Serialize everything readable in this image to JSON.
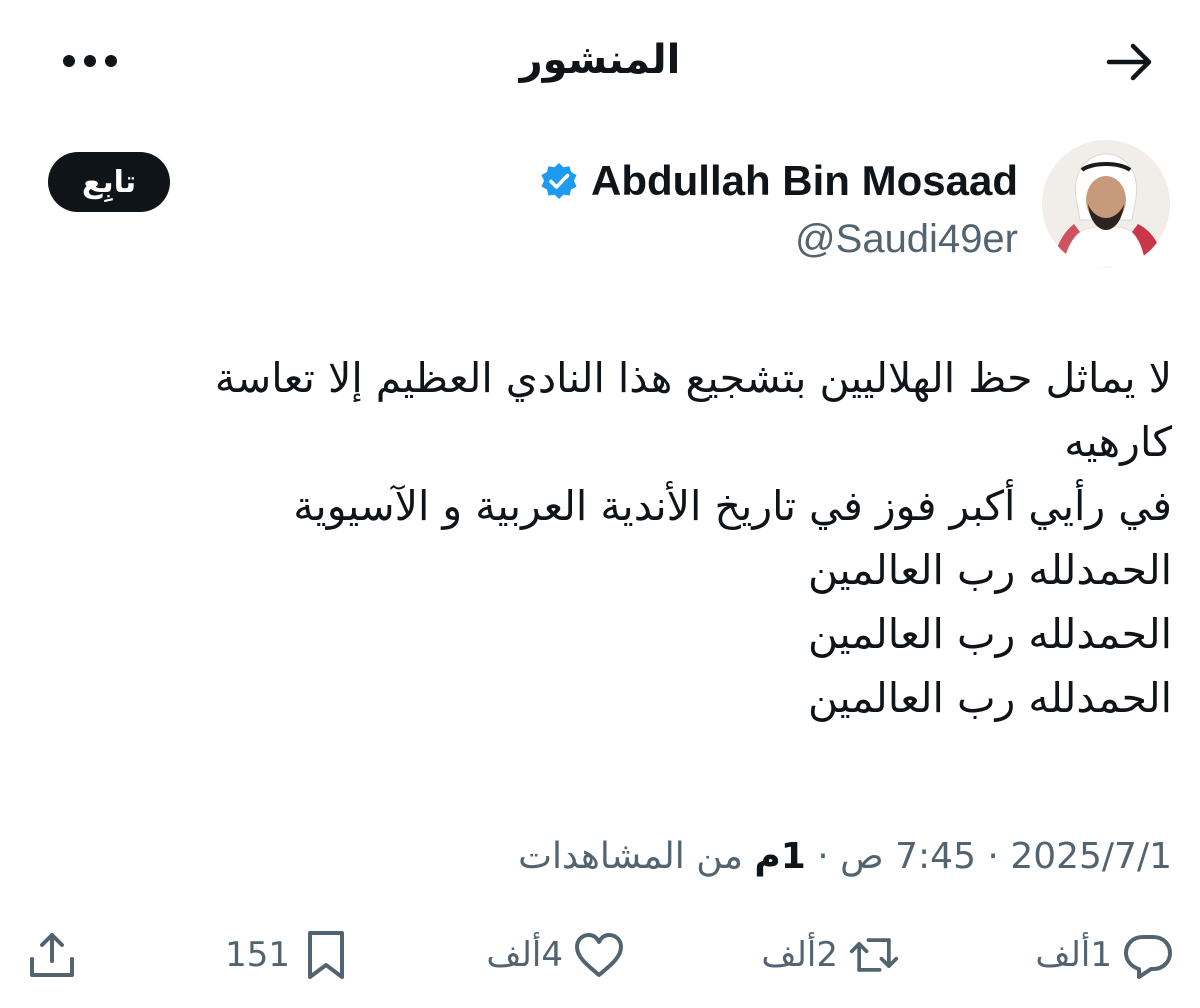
{
  "header": {
    "title": "المنشور"
  },
  "author": {
    "name": "Abdullah Bin Mosaad",
    "handle": "@Saudi49er",
    "verified": true,
    "follow_label": "تابِع"
  },
  "tweet": {
    "lines": [
      "لا يماثل حظ الهلاليين بتشجيع هذا النادي العظيم إلا تعاسة",
      "كارهيه",
      "في رأيي أكبر فوز في تاريخ الأندية العربية و الآسيوية",
      "الحمدلله رب العالمين",
      "الحمدلله رب العالمين",
      "الحمدلله رب العالمين"
    ]
  },
  "meta": {
    "date": "2025/7/1",
    "separator": " · ",
    "time": "7:45 ص",
    "views_count": "1م",
    "views_label": " من المشاهدات"
  },
  "actions": {
    "reply_count": "1ألف",
    "repost_count": "2ألف",
    "like_count": "4ألف",
    "bookmark_count": "151"
  },
  "icons": {
    "back": "arrow-right-icon",
    "more": "more-icon",
    "verified": "verified-badge-icon",
    "reply": "reply-icon",
    "repost": "repost-icon",
    "like": "heart-icon",
    "bookmark": "bookmark-icon",
    "share": "share-icon"
  },
  "colors": {
    "text": "#0f1419",
    "secondary": "#536471",
    "verified": "#1d9bf0",
    "follow_bg": "#0f1419"
  }
}
